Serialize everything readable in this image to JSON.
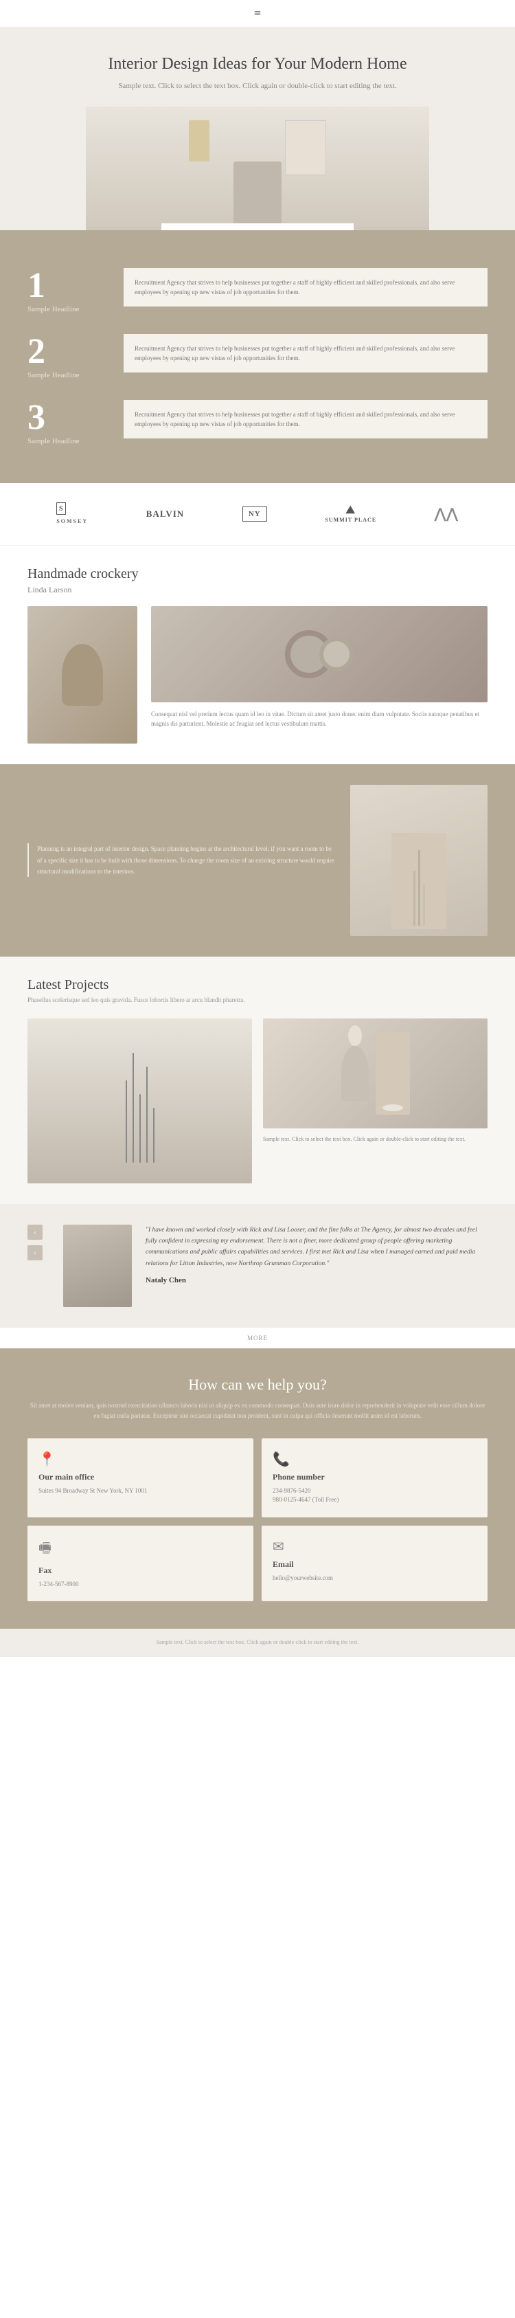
{
  "nav": {
    "hamburger": "≡"
  },
  "hero": {
    "title": "Interior Design Ideas for Your Modern Home",
    "subtitle": "Sample text. Click to select the text box. Click again or double-click to start editing the text."
  },
  "numbered": {
    "items": [
      {
        "number": "1",
        "label": "Sample Headline",
        "description": "Recruitment Agency that strives to help businesses put together a staff of highly efficient and skilled professionals, and also serve employees by opening up new vistas of job opportunities for them."
      },
      {
        "number": "2",
        "label": "Sample Headline",
        "description": "Recruitment Agency that strives to help businesses put together a staff of highly efficient and skilled professionals, and also serve employees by opening up new vistas of job opportunities for them."
      },
      {
        "number": "3",
        "label": "Sample Headline",
        "description": "Recruitment Agency that strives to help businesses put together a staff of highly efficient and skilled professionals, and also serve employees by opening up new vistas of job opportunities for them."
      }
    ]
  },
  "logos": [
    {
      "text": "SOMSEY",
      "style": "serif"
    },
    {
      "text": "BALVIN",
      "style": "normal"
    },
    {
      "text": "NY",
      "style": "outlined"
    },
    {
      "text": "SUMMIT PLACE",
      "style": "small"
    },
    {
      "text": "⋀⋀",
      "style": "mountain"
    }
  ],
  "crockery": {
    "title": "Handmade crockery",
    "author": "Linda Larson",
    "description": "Consequat nisl vel pretium lectus quam id leo in vitae. Dictum sit amet justo donec enim diam vulputate. Sociis natoque penatibus et magnis dis parturient. Molestie ac feugiat sed lectus vestibulum mattis."
  },
  "planning": {
    "text": "Planning is an integral part of interior design. Space planning begins at the architectural level; if you want a room to be of a specific size it has to be built with those dimensions. To change the room size of an existing structure would require structural modifications to the interiors."
  },
  "projects": {
    "title": "Latest Projects",
    "subtitle": "Phasellus scelerisque sed leo quis gravida. Fusce lobortis libero at arcu blandit pharetra.",
    "caption": "Sample text. Click to select the text box. Click again or double-click to start editing the text."
  },
  "testimonial": {
    "quote": "\"I have known and worked closely with Rick and Lisa Looser, and the fine folks at The Agency, for almost two decades and feel fully confident in expressing my endorsement. There is not a finer, more dedicated group of people offering marketing communications and public affairs capabilities and services. I first met Rick and Lisa when I managed earned and paid media relations for Litton Industries, now Northrop Grumman Corporation.\"",
    "name": "Nataly Chen",
    "more_label": "MORE"
  },
  "contact": {
    "title": "How can we help you?",
    "description": "Sit amet at molen veniam, quis nostrud exercitation ullamco laboris nisi ut aliquip ex ea commodo consequat. Duis aute irure dolor in reprehenderit in voluptate velit esse cillum dolore eu fugiat nulla pariatur. Excepteur sint occaecat cupidatat non proident, sunt in culpa qui officia deserunt mollit anim id est laborum.",
    "cards": [
      {
        "icon": "📍",
        "title": "Our main office",
        "info": "Suites 94 Broadway St New York, NY 1001"
      },
      {
        "icon": "📞",
        "title": "Phone number",
        "info": "234-9876-5420\n980-0125-4647 (Toll Free)"
      },
      {
        "icon": "🖷",
        "title": "Fax",
        "info": "1-234-567-8900"
      },
      {
        "icon": "✉",
        "title": "Email",
        "info": "hello@yourwebsite.com"
      }
    ]
  },
  "footer": {
    "text": "Sample text. Click to select the text box. Click again or double-click to start editing the text."
  }
}
